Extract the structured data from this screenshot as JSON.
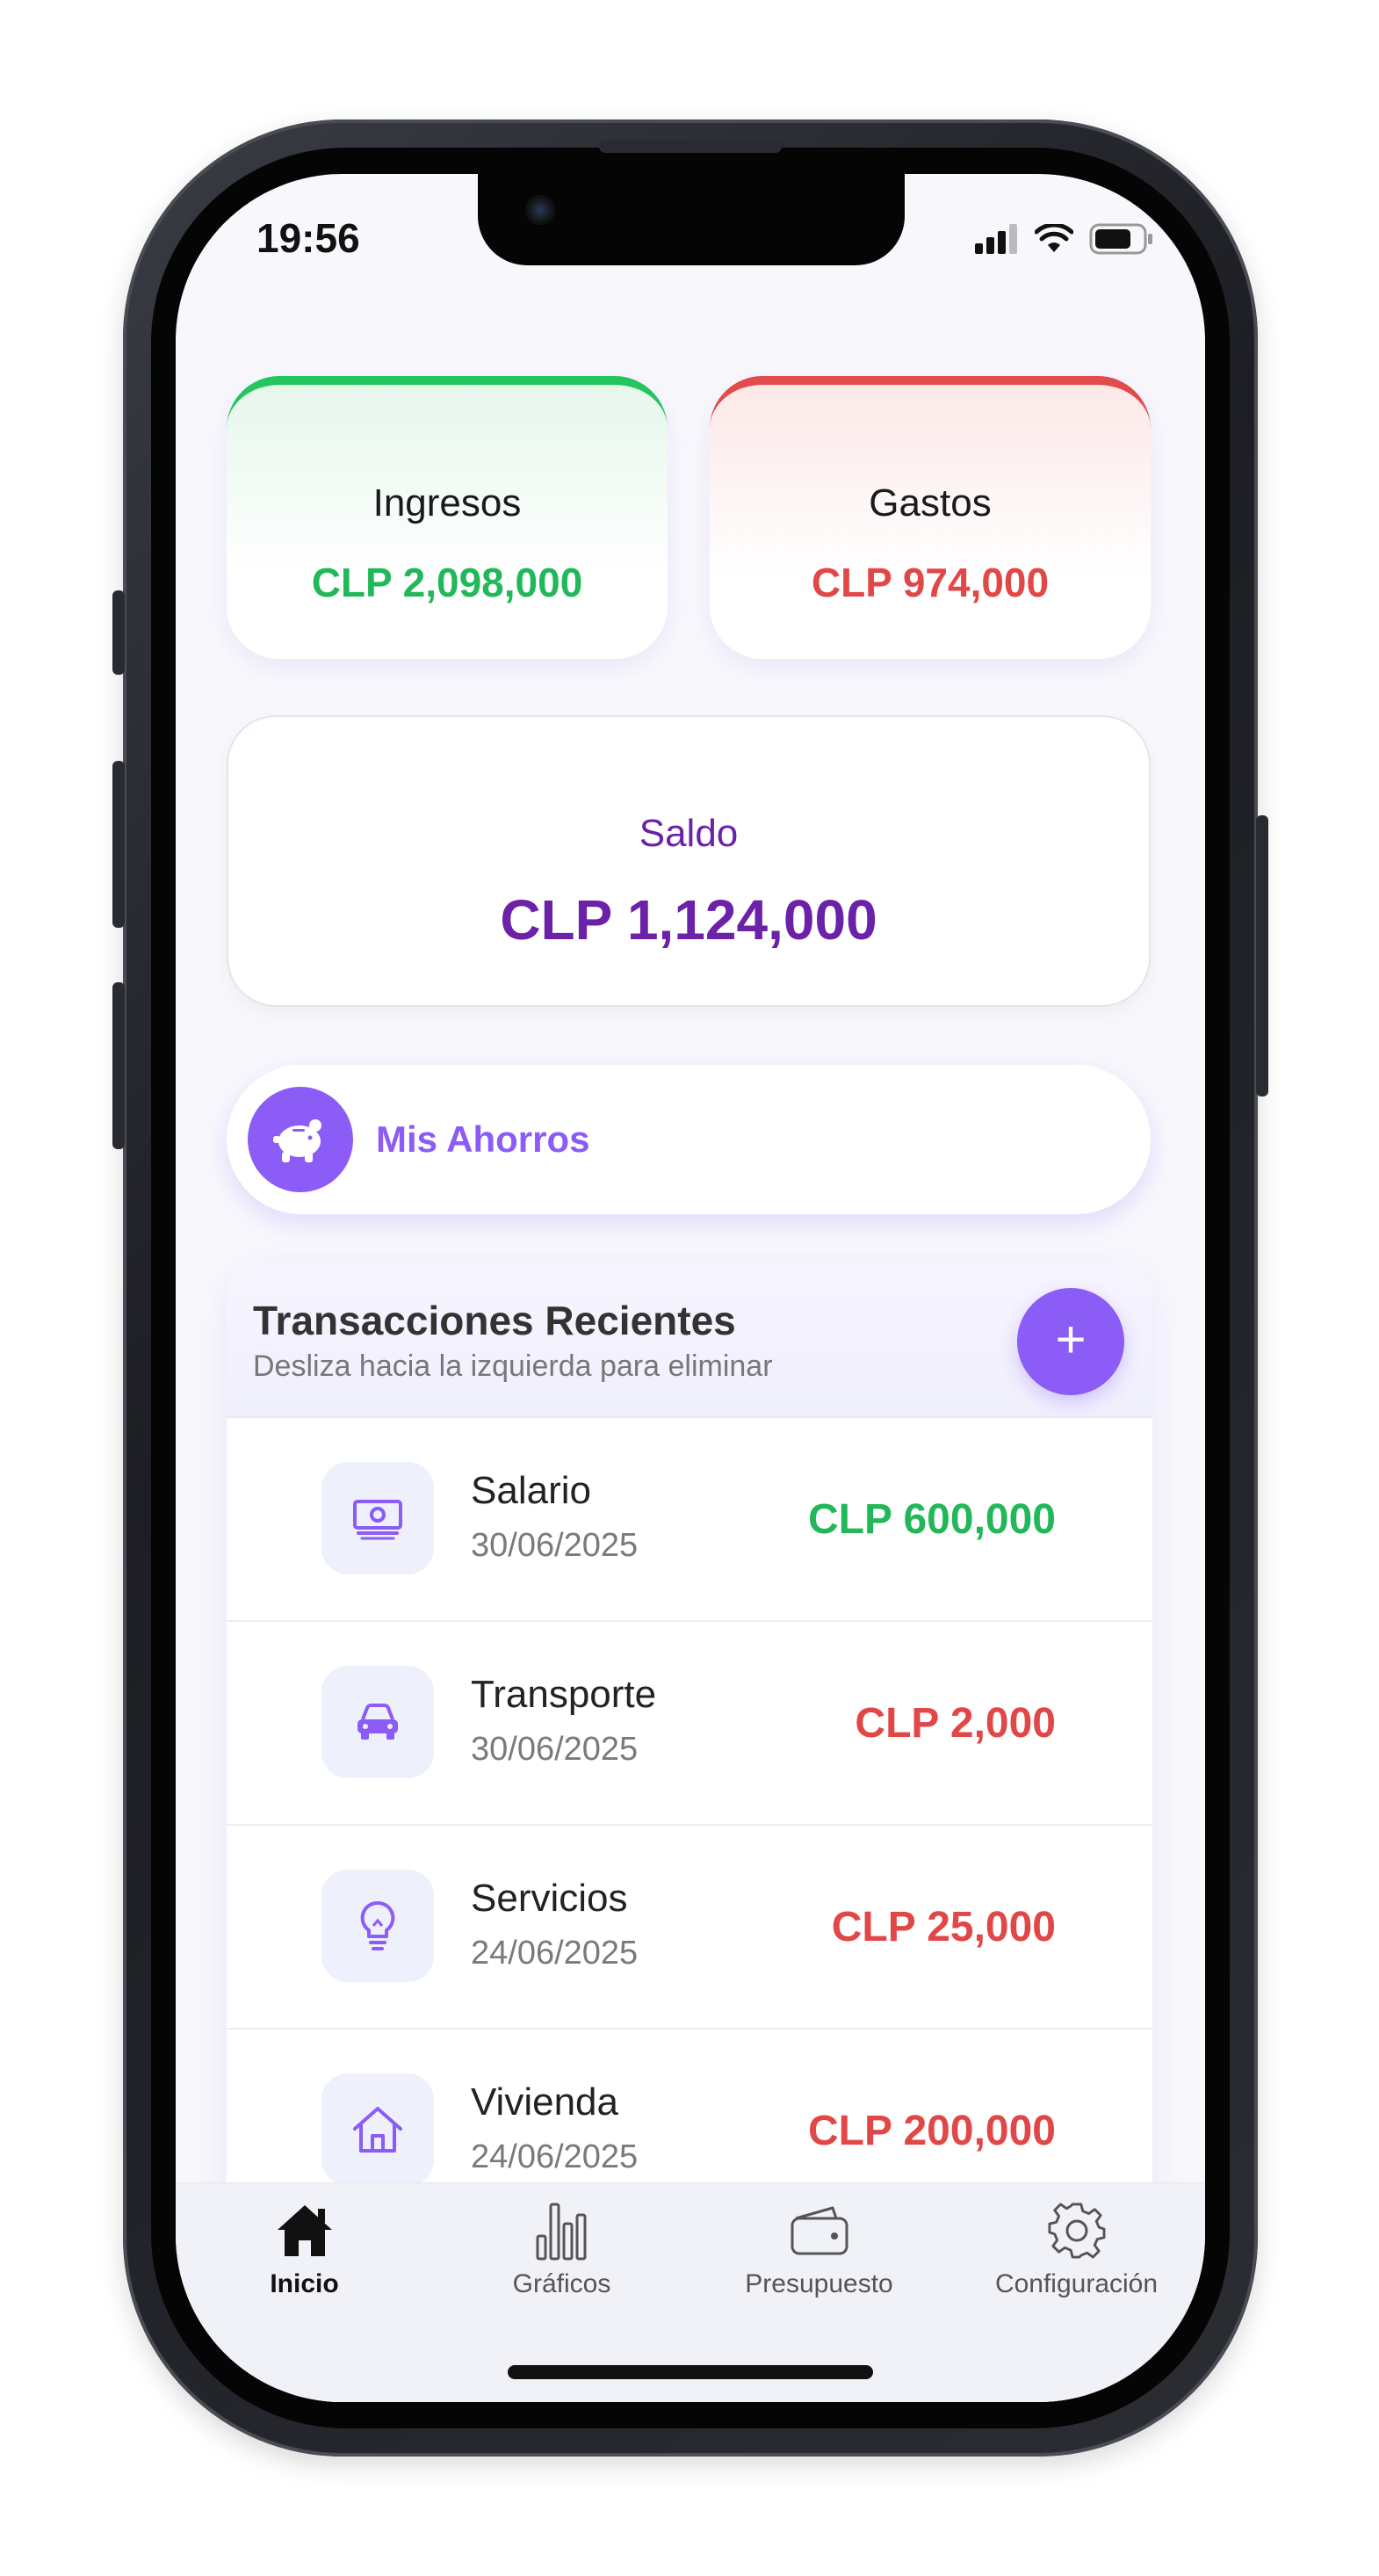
{
  "status_bar": {
    "time": "19:56",
    "icons": [
      "signal-icon",
      "wifi-icon",
      "battery-icon"
    ]
  },
  "summary": {
    "income": {
      "label": "Ingresos",
      "amount": "CLP 2,098,000",
      "color": "#22b85a"
    },
    "expense": {
      "label": "Gastos",
      "amount": "CLP 974,000",
      "color": "#e24747"
    }
  },
  "balance": {
    "label": "Saldo",
    "amount": "CLP 1,124,000",
    "color": "#6b21a8"
  },
  "savings": {
    "label": "Mis Ahorros",
    "icon": "piggy-bank-icon"
  },
  "transactions": {
    "title": "Transacciones Recientes",
    "subtitle": "Desliza hacia la izquierda para eliminar",
    "add_label": "+",
    "items": [
      {
        "name": "Salario",
        "date": "30/06/2025",
        "amount": "CLP 600,000",
        "type": "income",
        "icon": "money-icon"
      },
      {
        "name": "Transporte",
        "date": "30/06/2025",
        "amount": "CLP 2,000",
        "type": "expense",
        "icon": "car-icon"
      },
      {
        "name": "Servicios",
        "date": "24/06/2025",
        "amount": "CLP 25,000",
        "type": "expense",
        "icon": "lightbulb-icon"
      },
      {
        "name": "Vivienda",
        "date": "24/06/2025",
        "amount": "CLP 200,000",
        "type": "expense",
        "icon": "house-icon"
      }
    ]
  },
  "tabs": [
    {
      "label": "Inicio",
      "icon": "home-icon",
      "active": true
    },
    {
      "label": "Gráficos",
      "icon": "bar-chart-icon",
      "active": false
    },
    {
      "label": "Presupuesto",
      "icon": "wallet-icon",
      "active": false
    },
    {
      "label": "Configuración",
      "icon": "gear-icon",
      "active": false
    }
  ],
  "colors": {
    "accent": "#8b5cf6",
    "income": "#22b85a",
    "expense": "#e24747"
  }
}
